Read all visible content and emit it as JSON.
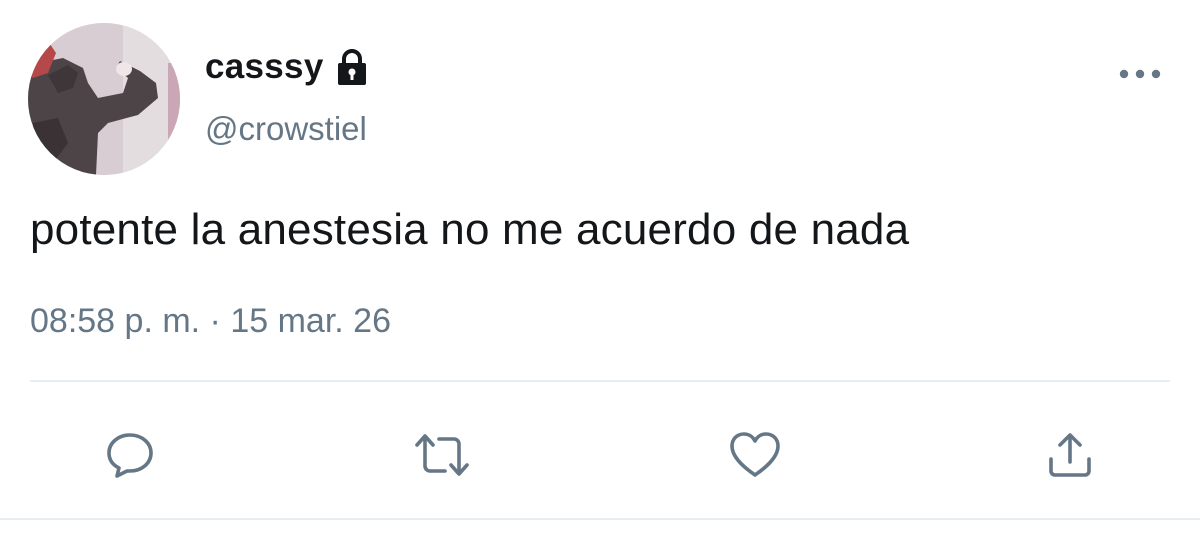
{
  "user": {
    "display_name": "casssy",
    "handle": "@crowstiel",
    "protected_icon": "lock-icon"
  },
  "tweet": {
    "text": "potente la anestesia no me acuerdo de nada",
    "time": "08:58 p. m.",
    "separator": " · ",
    "date": "15 mar. 26"
  },
  "menu": {
    "icon": "more-horizontal-icon"
  },
  "actions": [
    {
      "name": "reply",
      "icon": "reply-icon"
    },
    {
      "name": "retweet",
      "icon": "retweet-icon"
    },
    {
      "name": "like",
      "icon": "heart-icon"
    },
    {
      "name": "share",
      "icon": "share-icon"
    }
  ],
  "colors": {
    "text_primary": "#14171a",
    "text_secondary": "#657786",
    "divider": "#e6ecf0",
    "icon": "#657786"
  }
}
